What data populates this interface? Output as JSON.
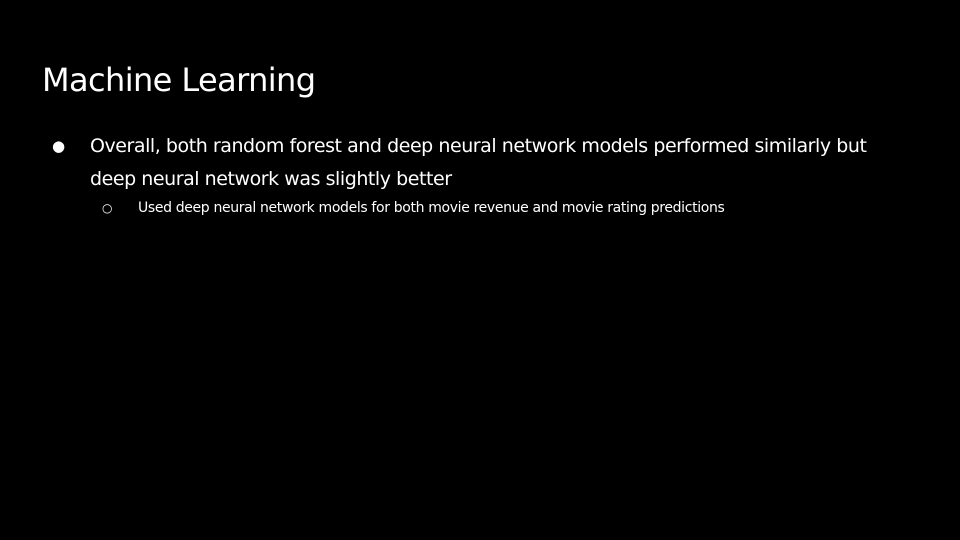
{
  "slide": {
    "title": "Machine Learning",
    "background_color": "#000000",
    "text_color": "#ffffff",
    "bullets": [
      {
        "marker": "●",
        "text": "Overall, both random forest and deep neural network models performed similarly but deep neural network was slightly better",
        "sub_bullets": [
          {
            "marker": "○",
            "text": "Used deep neural network models for both movie revenue and movie rating predictions"
          }
        ]
      }
    ]
  }
}
